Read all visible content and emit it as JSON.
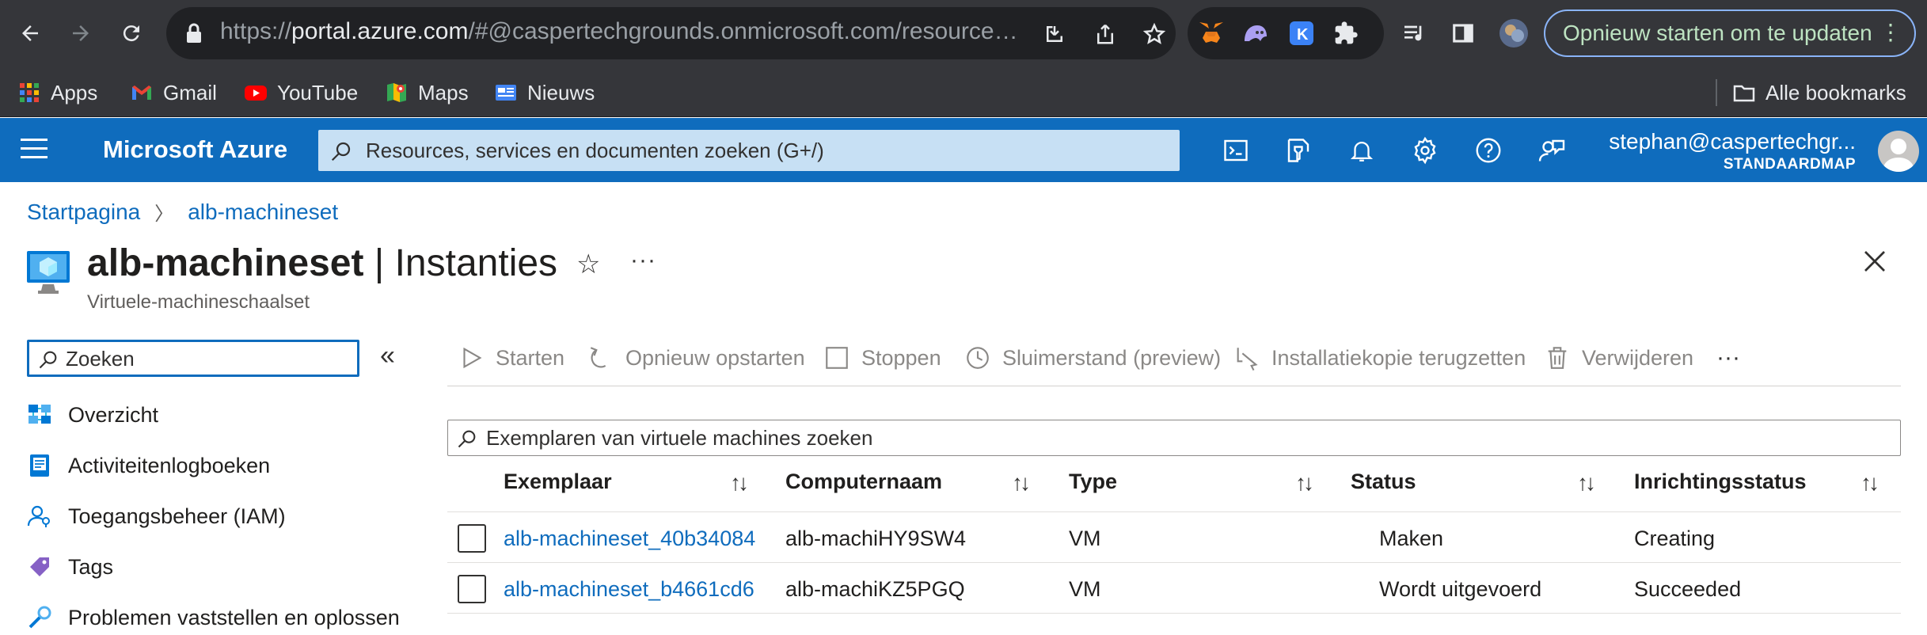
{
  "browser": {
    "url_prefix": "https://",
    "url_host": "portal.azure.com",
    "url_rest": "/#@caspertechgrounds.onmicrosoft.com/resource…",
    "update_button": "Opnieuw starten om te updaten",
    "bookmarks": [
      "Apps",
      "Gmail",
      "YouTube",
      "Maps",
      "Nieuws"
    ],
    "all_bookmarks": "Alle bookmarks"
  },
  "header": {
    "brand": "Microsoft Azure",
    "search_placeholder": "Resources, services en documenten zoeken (G+/)",
    "account_name": "stephan@caspertechgr...",
    "account_directory": "STANDAARDMAP"
  },
  "breadcrumb": {
    "home": "Startpagina",
    "current": "alb-machineset"
  },
  "page": {
    "title_resource": "alb-machineset",
    "title_separator": " | ",
    "title_section": "Instanties",
    "subtitle": "Virtuele-machineschaalset"
  },
  "sidebar": {
    "search_placeholder": "Zoeken",
    "items": [
      {
        "label": "Overzicht",
        "icon": "overview-icon"
      },
      {
        "label": "Activiteitenlogboeken",
        "icon": "activity-log-icon"
      },
      {
        "label": "Toegangsbeheer (IAM)",
        "icon": "iam-icon"
      },
      {
        "label": "Tags",
        "icon": "tag-icon"
      },
      {
        "label": "Problemen vaststellen en oplossen",
        "icon": "diagnose-icon"
      }
    ]
  },
  "toolbar": {
    "start": "Starten",
    "restart": "Opnieuw opstarten",
    "stop": "Stoppen",
    "hibernate": "Sluimerstand (preview)",
    "reimage": "Installatiekopie terugzetten",
    "delete": "Verwijderen"
  },
  "instances": {
    "search_placeholder": "Exemplaren van virtuele machines zoeken",
    "columns": [
      "Exemplaar",
      "Computernaam",
      "Type",
      "Status",
      "Inrichtingsstatus"
    ],
    "rows": [
      {
        "instance": "alb-machineset_40b34084",
        "computer": "alb-machiHY9SW4",
        "type": "VM",
        "status": "Maken",
        "provisioning": "Creating"
      },
      {
        "instance": "alb-machineset_b4661cd6",
        "computer": "alb-machiKZ5PGQ",
        "type": "VM",
        "status": "Wordt uitgevoerd",
        "provisioning": "Succeeded"
      }
    ]
  },
  "colors": {
    "azure_blue": "#0f6cbd",
    "chrome_dark": "#35363a",
    "link": "#0f6cbd"
  }
}
